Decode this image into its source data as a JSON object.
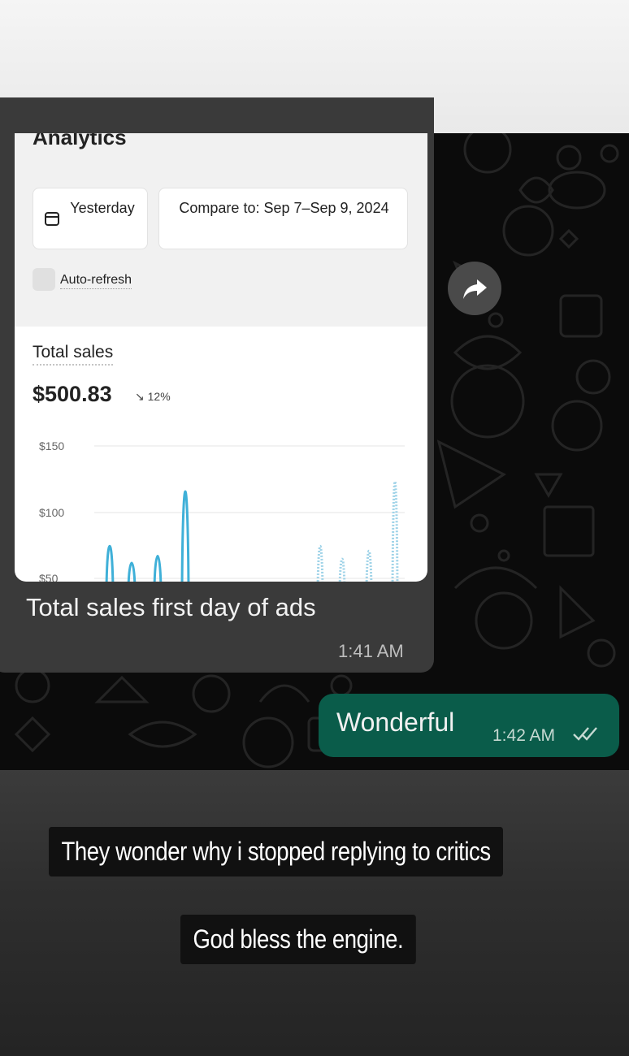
{
  "analytics": {
    "title": "Analytics",
    "date_range": "Yesterday",
    "compare": "Compare to: Sep 7–Sep 9, 2024",
    "auto_refresh": "Auto-refresh",
    "total_sales_label": "Total sales",
    "total_sales_value": "$500.83",
    "change": "↘ 12%"
  },
  "chart_data": {
    "type": "line",
    "y_ticks": [
      "$150",
      "$100",
      "$50"
    ],
    "series": [
      {
        "style": "solid",
        "color": "#3fb0d8",
        "spikes": [
          85,
          68,
          75,
          140
        ]
      },
      {
        "style": "dotted",
        "color": "#9fd3e8",
        "spikes": [
          85,
          72,
          80,
          150
        ]
      }
    ]
  },
  "incoming": {
    "caption": "Total sales first day of ads",
    "time": "1:41 AM"
  },
  "outgoing": {
    "text": "Wonderful",
    "time": "1:42 AM"
  },
  "story": {
    "line1": "They wonder why i stopped replying to critics",
    "line2": "God bless the engine."
  },
  "icons": {
    "forward": "forward-arrow-icon",
    "read": "double-check-icon",
    "calendar": "calendar-icon"
  }
}
